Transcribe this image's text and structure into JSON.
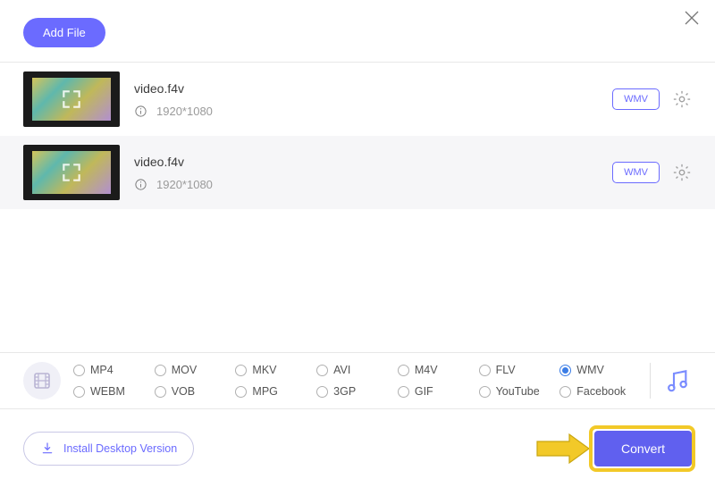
{
  "header": {
    "add_file_label": "Add File"
  },
  "files": [
    {
      "name": "video.f4v",
      "dimensions": "1920*1080",
      "format": "WMV"
    },
    {
      "name": "video.f4v",
      "dimensions": "1920*1080",
      "format": "WMV"
    }
  ],
  "formats": {
    "row1": [
      "MP4",
      "MOV",
      "MKV",
      "AVI",
      "M4V",
      "FLV",
      "WMV"
    ],
    "row2": [
      "WEBM",
      "VOB",
      "MPG",
      "3GP",
      "GIF",
      "YouTube",
      "Facebook"
    ],
    "selected": "WMV"
  },
  "footer": {
    "install_label": "Install Desktop Version",
    "convert_label": "Convert"
  }
}
